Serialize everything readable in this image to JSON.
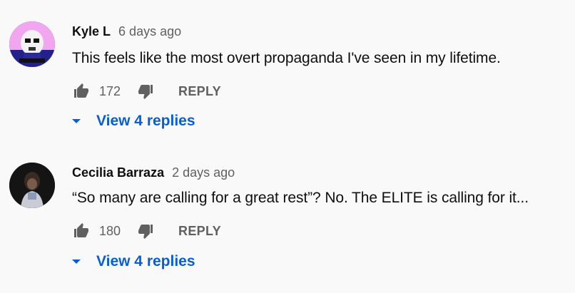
{
  "comments": [
    {
      "author": "Kyle L",
      "time": "6 days ago",
      "text": "This feels like the most overt propaganda I've seen in my lifetime.",
      "likes": "172",
      "reply_label": "REPLY",
      "replies_label": "View 4 replies"
    },
    {
      "author": "Cecilia Barraza",
      "time": "2 days ago",
      "text": "“So many are calling for a great rest”? No. The ELITE is calling for it...",
      "likes": "180",
      "reply_label": "REPLY",
      "replies_label": "View 4 replies"
    }
  ],
  "icons": {
    "like": "thumbs-up-icon",
    "dislike": "thumbs-down-icon",
    "expand": "chevron-down-icon"
  },
  "colors": {
    "background": "#f9f9f9",
    "link": "#065fd4",
    "secondary_text": "#606060",
    "icon": "#606060"
  }
}
